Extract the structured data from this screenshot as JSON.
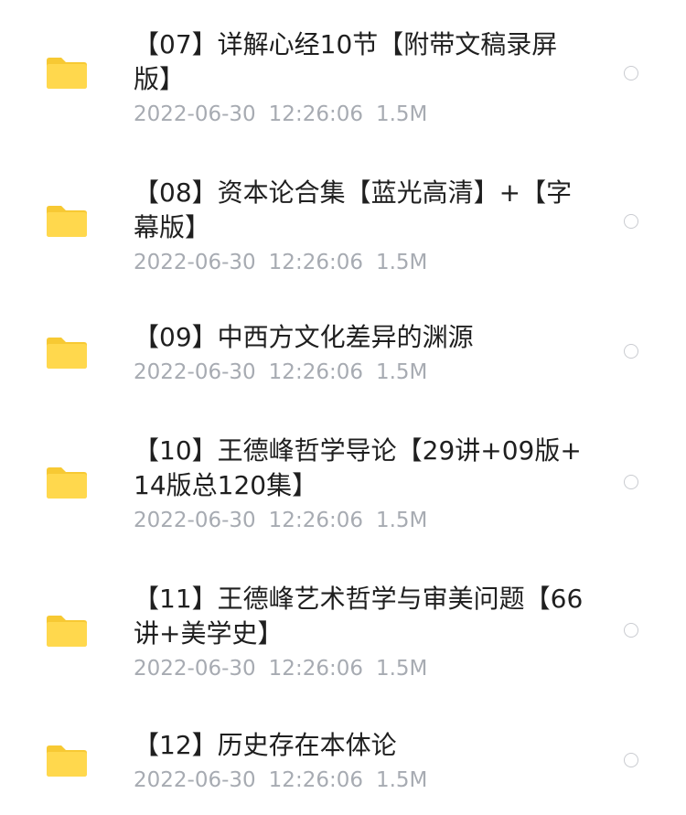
{
  "files": [
    {
      "title": "【07】详解心经10节【附带文稿录屏版】",
      "date": "2022-06-30",
      "time": "12:26:06",
      "size": "1.5M"
    },
    {
      "title": "【08】资本论合集【蓝光高清】+【字幕版】",
      "date": "2022-06-30",
      "time": "12:26:06",
      "size": "1.5M"
    },
    {
      "title": "【09】中西方文化差异的渊源",
      "date": "2022-06-30",
      "time": "12:26:06",
      "size": "1.5M"
    },
    {
      "title": "【10】王德峰哲学导论【29讲+09版+14版总120集】",
      "date": "2022-06-30",
      "time": "12:26:06",
      "size": "1.5M"
    },
    {
      "title": "【11】王德峰艺术哲学与审美问题【66讲+美学史】",
      "date": "2022-06-30",
      "time": "12:26:06",
      "size": "1.5M"
    },
    {
      "title": "【12】历史存在本体论",
      "date": "2022-06-30",
      "time": "12:26:06",
      "size": "1.5M"
    }
  ],
  "colors": {
    "folder": "#ffd84d",
    "folder_tab": "#f7c933",
    "title_text": "#1f1f1f",
    "meta_text": "#a7abb2",
    "radio_border": "#c9cbd0"
  },
  "icons": {
    "folder": "folder-icon",
    "radio": "radio-unchecked-icon"
  }
}
